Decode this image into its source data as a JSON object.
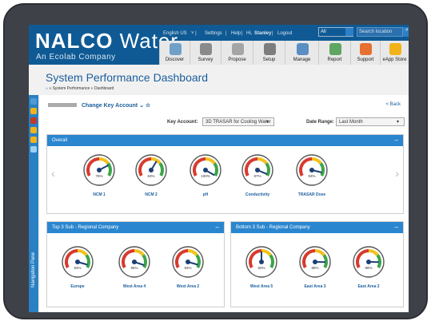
{
  "brand": {
    "name_bold": "NALCO",
    "name_light": "Water",
    "tagline": "An Ecolab Company"
  },
  "topnav": {
    "lang": "English US",
    "settings": "Settings",
    "help": "Help",
    "greeting": "Hi,",
    "user": "Stanley",
    "logout": "Logout",
    "filter": "All",
    "search_placeholder": "Search location",
    "search_icon": "search-icon"
  },
  "toolbar": [
    {
      "label": "Discover",
      "icon": "discover-icon",
      "color": "#6fa0c8"
    },
    {
      "label": "Survey",
      "icon": "survey-icon",
      "color": "#8a8a8a"
    },
    {
      "label": "Propose",
      "icon": "propose-icon",
      "color": "#a5a5a5"
    },
    {
      "label": "Setup",
      "icon": "setup-icon",
      "color": "#7d7d7d"
    },
    {
      "label": "Manage",
      "icon": "manage-icon",
      "color": "#5b8ec2"
    },
    {
      "label": "Report",
      "icon": "report-icon",
      "color": "#5ea661"
    },
    {
      "label": "Support",
      "icon": "support-icon",
      "color": "#e57030"
    },
    {
      "label": "eApp Store",
      "icon": "lightbulb-icon",
      "color": "#f2b21a"
    }
  ],
  "sidebar": {
    "label": "Navigation Pane",
    "icons": [
      "collapse-icon",
      "key-icon",
      "record-icon",
      "star-icon",
      "warning-icon",
      "sites-icon"
    ]
  },
  "page": {
    "title": "System Performance Dashboard",
    "breadcrumb": "» System Performance » Dashboard"
  },
  "account": {
    "link": "Change Key Account",
    "back": "< Back",
    "key_account_label": "Key Account:",
    "key_account_value": "3D TRASAR for Cooling Water",
    "date_range_label": "Date Range:",
    "date_range_value": "Last Month"
  },
  "overall": {
    "title": "Overall",
    "gauges": [
      {
        "label": "NCM 1",
        "value": "76%",
        "level": 76
      },
      {
        "label": "NCM 2",
        "value": "63%",
        "level": 63
      },
      {
        "label": "pH",
        "value": "100%",
        "level": 100
      },
      {
        "label": "Conductivity",
        "value": "97%",
        "level": 97
      },
      {
        "label": "TRASAR Dose",
        "value": "93%",
        "level": 93
      }
    ]
  },
  "top3": {
    "title": "Top 3 Sub - Regional Company",
    "gauges": [
      {
        "label": "Europe",
        "value": "94%",
        "level": 94
      },
      {
        "label": "West Area 4",
        "value": "95%",
        "level": 95
      },
      {
        "label": "West Area 2",
        "value": "94%",
        "level": 94
      }
    ]
  },
  "bottom3": {
    "title": "Bottom 3 Sub - Regional Company",
    "gauges": [
      {
        "label": "West Area 5",
        "value": "50%",
        "level": 50
      },
      {
        "label": "East Area 3",
        "value": "88%",
        "level": 88
      },
      {
        "label": "East Area 2",
        "value": "88%",
        "level": 88
      }
    ]
  }
}
